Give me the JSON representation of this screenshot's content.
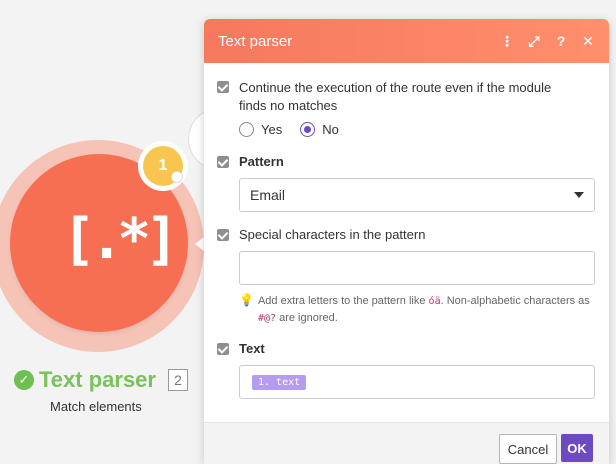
{
  "module": {
    "badge": "1",
    "icon_glyph": "[.*]",
    "icon": "regex-brackets-icon",
    "status_icon": "check-circle-icon",
    "title": "Text parser",
    "index": "2",
    "subtitle": "Match elements"
  },
  "panel": {
    "title": "Text parser",
    "header_icons": [
      {
        "name": "more-vertical-icon",
        "glyph": "⋮"
      },
      {
        "name": "expand-icon",
        "glyph": "⤢"
      },
      {
        "name": "help-icon",
        "glyph": "?"
      },
      {
        "name": "close-icon",
        "glyph": "✕"
      }
    ],
    "continue_label": "Continue the execution of the route even if the module finds no matches",
    "radio_yes": "Yes",
    "radio_no": "No",
    "radio_selected": "No",
    "pattern_label": "Pattern",
    "pattern_value": "Email",
    "special_label": "Special characters in the pattern",
    "special_value": "",
    "hint_part1": "Add extra letters to the pattern like ",
    "hint_code1": "óä",
    "hint_part2": ". Non-alphabetic characters as ",
    "hint_code2": "#@?",
    "hint_part3": " are ignored.",
    "text_label": "Text",
    "text_chip": "1. text",
    "cancel": "Cancel",
    "ok": "OK"
  },
  "colors": {
    "module": "#f66f53",
    "accent": "#6d4ac2",
    "success": "#7ac25b",
    "chip": "#b69cf0"
  }
}
